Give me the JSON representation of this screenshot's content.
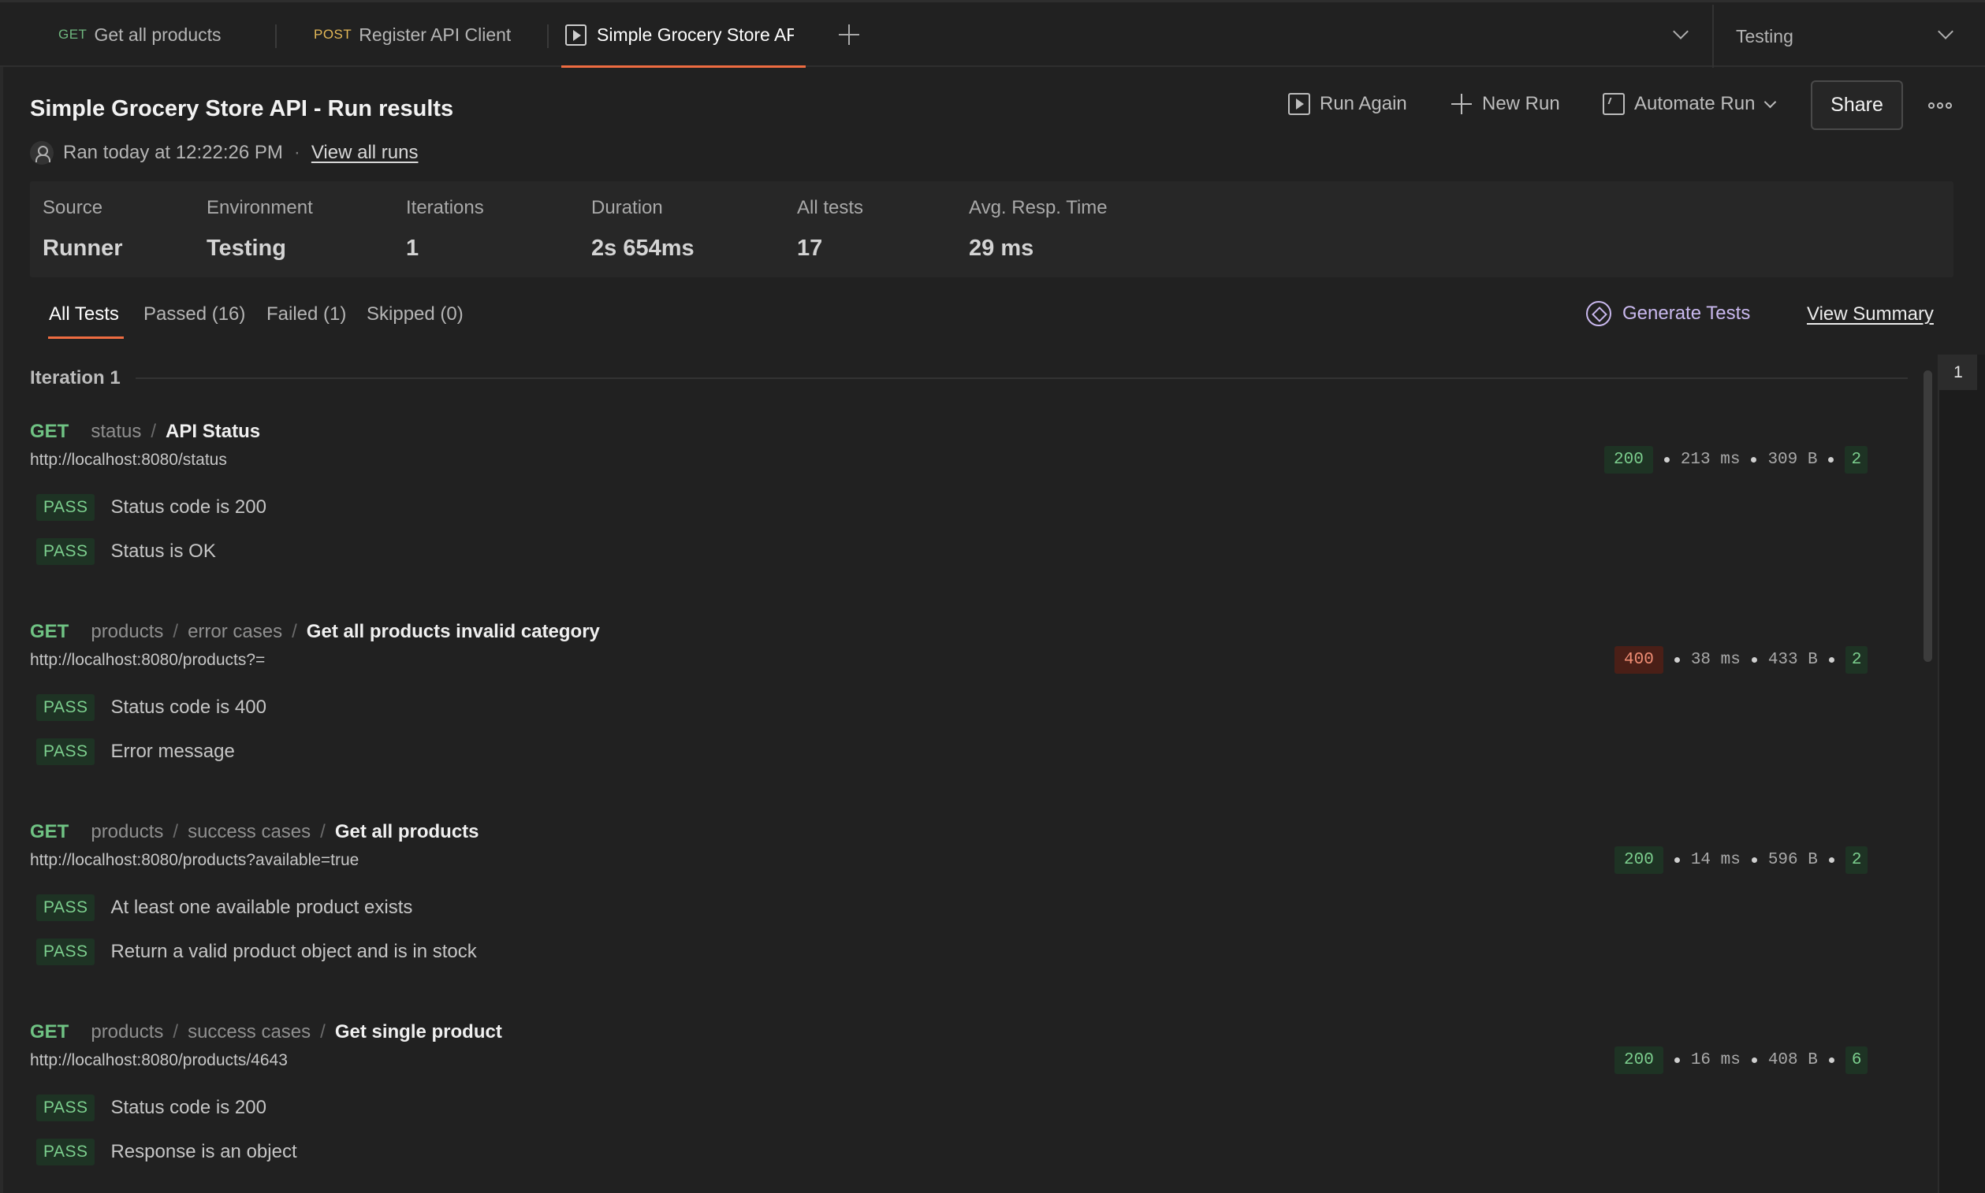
{
  "tabs": [
    {
      "method": "GET",
      "label": "Get all products"
    },
    {
      "method": "POST",
      "label": "Register API Client"
    },
    {
      "method": "",
      "label": "Simple Grocery Store AP"
    }
  ],
  "environment_selector": {
    "value": "Testing"
  },
  "header": {
    "title": "Simple Grocery Store API - Run results",
    "ran_at": "Ran today at 12:22:26 PM",
    "separator": "·",
    "view_all_runs": "View all runs"
  },
  "actions": {
    "run_again": "Run Again",
    "new_run": "New Run",
    "automate_run": "Automate Run",
    "share": "Share"
  },
  "stats": {
    "source": {
      "label": "Source",
      "value": "Runner"
    },
    "environment": {
      "label": "Environment",
      "value": "Testing"
    },
    "iterations": {
      "label": "Iterations",
      "value": "1"
    },
    "duration": {
      "label": "Duration",
      "value": "2s 654ms"
    },
    "all_tests": {
      "label": "All tests",
      "value": "17"
    },
    "avg_resp": {
      "label": "Avg. Resp. Time",
      "value": "29 ms"
    }
  },
  "filters": {
    "all": "All Tests",
    "passed": "Passed (16)",
    "failed": "Failed (1)",
    "skipped": "Skipped (0)",
    "generate_tests": "Generate Tests",
    "view_summary": "View Summary"
  },
  "iteration": {
    "label": "Iteration 1",
    "page": "1"
  },
  "requests": [
    {
      "method": "GET",
      "crumbs": [
        "status"
      ],
      "name": "API Status",
      "url": "http://localhost:8080/status",
      "status": "200",
      "time": "213 ms",
      "size": "309 B",
      "count": "2",
      "status_color": "#7ccf8e",
      "tests": [
        {
          "badge": "PASS",
          "text": "Status code is 200"
        },
        {
          "badge": "PASS",
          "text": "Status is OK"
        }
      ]
    },
    {
      "method": "GET",
      "crumbs": [
        "products",
        "error cases"
      ],
      "name": "Get all products invalid category",
      "url": "http://localhost:8080/products?=",
      "status": "400",
      "time": "38 ms",
      "size": "433 B",
      "count": "2",
      "status_color": "#f08d74",
      "tests": [
        {
          "badge": "PASS",
          "text": "Status code is 400"
        },
        {
          "badge": "PASS",
          "text": "Error message"
        }
      ]
    },
    {
      "method": "GET",
      "crumbs": [
        "products",
        "success cases"
      ],
      "name": "Get all products",
      "url": "http://localhost:8080/products?available=true",
      "status": "200",
      "time": "14 ms",
      "size": "596 B",
      "count": "2",
      "status_color": "#7ccf8e",
      "tests": [
        {
          "badge": "PASS",
          "text": "At least one available product exists"
        },
        {
          "badge": "PASS",
          "text": "Return a valid product object and is in stock"
        }
      ]
    },
    {
      "method": "GET",
      "crumbs": [
        "products",
        "success cases"
      ],
      "name": "Get single product",
      "url": "http://localhost:8080/products/4643",
      "status": "200",
      "time": "16 ms",
      "size": "408 B",
      "count": "6",
      "status_color": "#7ccf8e",
      "tests": [
        {
          "badge": "PASS",
          "text": "Status code is 200"
        },
        {
          "badge": "PASS",
          "text": "Response is an object"
        }
      ]
    }
  ],
  "colors": {
    "accent": "#ef6c41",
    "pass": "#7ccf8e",
    "fail": "#f08d74",
    "get": "#6fc283",
    "post": "#e3b857"
  }
}
